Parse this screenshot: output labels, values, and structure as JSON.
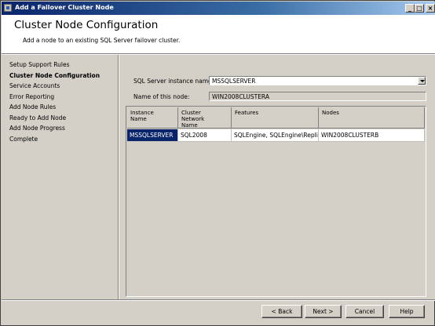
{
  "window": {
    "title": "Add a Failover Cluster Node"
  },
  "header": {
    "title": "Cluster Node Configuration",
    "subtitle": "Add a node to an existing SQL Server failover cluster."
  },
  "nav": {
    "items": [
      {
        "label": "Setup Support Rules"
      },
      {
        "label": "Cluster Node Configuration",
        "active": true
      },
      {
        "label": "Service Accounts"
      },
      {
        "label": "Error Reporting"
      },
      {
        "label": "Add Node Rules"
      },
      {
        "label": "Ready to Add Node"
      },
      {
        "label": "Add Node Progress"
      },
      {
        "label": "Complete"
      }
    ]
  },
  "form": {
    "instance_label": "SQL Server instance name:",
    "instance_value": "MSSQLSERVER",
    "node_label": "Name of this node:",
    "node_value": "WIN2008CLUSTERA"
  },
  "table": {
    "headers": [
      "Instance\nName",
      "Cluster\nNetwork\nName",
      "Features",
      "Nodes"
    ],
    "rows": [
      [
        "MSSQLSERVER",
        "SQL2008",
        "SQLEngine, SQLEngine\\Replic...",
        "WIN2008CLUSTERB"
      ]
    ]
  },
  "buttons": {
    "back": "< Back",
    "next": "Next >",
    "cancel": "Cancel",
    "help": "Help"
  },
  "colors": {
    "title_bar": "#0a246a",
    "selection": "#0a246a",
    "face": "#d4d0c8"
  }
}
